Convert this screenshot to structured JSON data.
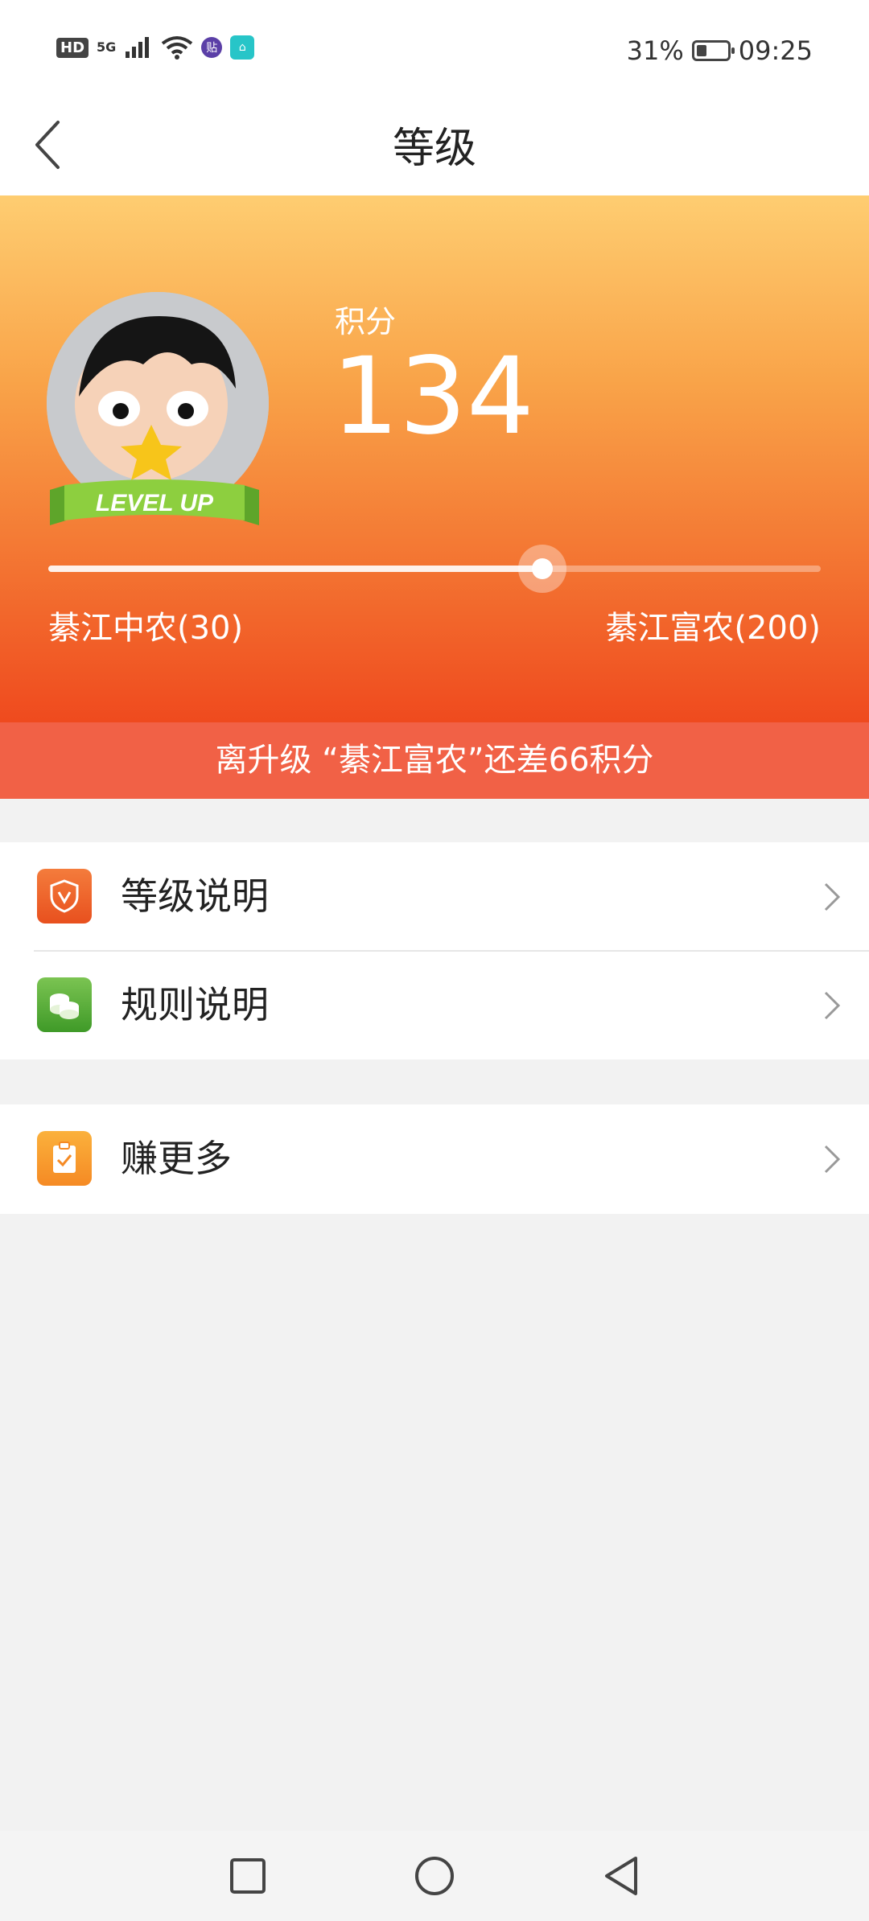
{
  "status_bar": {
    "network_badge": "HD",
    "network_type": "5G",
    "app_icon_1": "贴",
    "app_icon_2": "⌂",
    "battery_percent": "31%",
    "battery_level": 0.31,
    "time": "09:25"
  },
  "header": {
    "title": "等级",
    "back_icon": "chevron-left-icon"
  },
  "hero": {
    "points_label": "积分",
    "points_value": "134",
    "badge_text": "LEVEL UP",
    "current_level": "綦江中农(30)",
    "next_level": "綦江富农(200)",
    "progress_fraction": 0.64,
    "upgrade_message": "离升级 “綦江富农”还差66积分"
  },
  "menu": {
    "items": [
      {
        "label": "等级说明",
        "icon": "shield-v-icon",
        "color": "#ef5a24"
      },
      {
        "label": "规则说明",
        "icon": "coins-icon",
        "color": "#4fa832"
      },
      {
        "label": "赚更多",
        "icon": "clipboard-check-icon",
        "color": "#f79a2b"
      }
    ]
  },
  "colors": {
    "hero_top": "#fecd71",
    "hero_bottom": "#ef4a1e",
    "upgrade_bar": "#f16146",
    "background": "#f2f2f2"
  }
}
